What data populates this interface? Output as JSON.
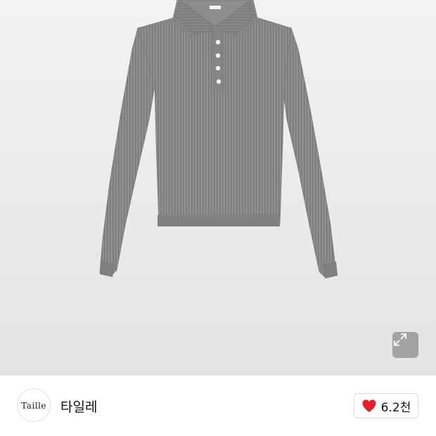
{
  "product": {
    "image_alt_icon": "knit-polo-sweater-image",
    "sweater_color": "#8a8a8a",
    "background_color": "#ececec"
  },
  "expand": {
    "icon": "expand-arrows-icon"
  },
  "shop": {
    "logo_text": "Taille",
    "name": "타일레"
  },
  "like": {
    "icon": "heart-icon",
    "icon_color": "#e5202e",
    "count": "6.2천"
  }
}
